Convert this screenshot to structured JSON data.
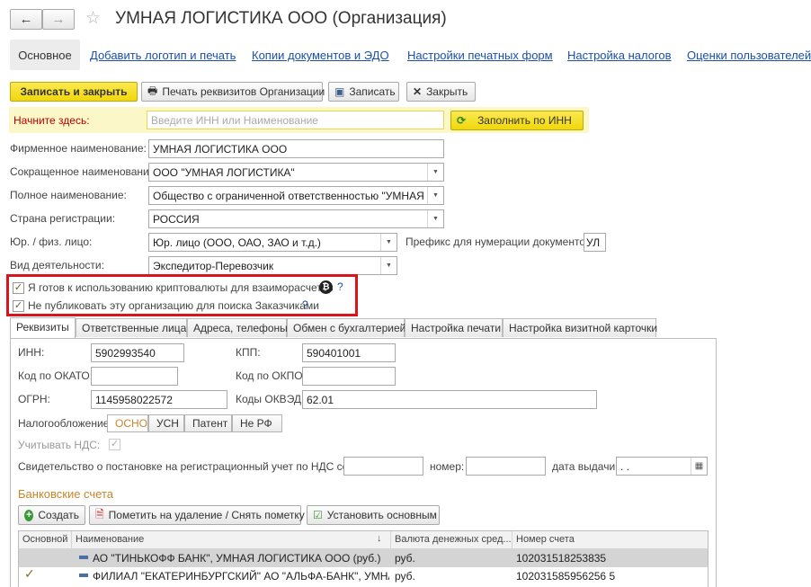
{
  "window": {
    "title": "УМНАЯ ЛОГИСТИКА ООО (Организация)",
    "back_icon": "arrow-left-icon",
    "forward_icon": "arrow-right-icon",
    "favorite_icon": "star-icon"
  },
  "nav_tabs": [
    {
      "label": "Основное"
    },
    {
      "label": "Добавить логотип и печать"
    },
    {
      "label": "Копии документов и ЭДО"
    },
    {
      "label": "Настройки печатных форм"
    },
    {
      "label": "Настройка налогов"
    },
    {
      "label": "Оценки пользователей"
    }
  ],
  "toolbar": {
    "save_close": "Записать и закрыть",
    "print_requisites": "Печать реквизитов Организации",
    "save": "Записать",
    "close": "Закрыть"
  },
  "start": {
    "label": "Начните здесь:",
    "placeholder": "Введите ИНН или Наименование",
    "fill_button": "Заполнить по ИНН"
  },
  "fields": {
    "firm_name_label": "Фирменное наименование:",
    "firm_name_value": "УМНАЯ ЛОГИСТИКА ООО",
    "short_name_label": "Сокращенное наименование:",
    "short_name_value": "ООО \"УМНАЯ ЛОГИСТИКА\"",
    "full_name_label": "Полное наименование:",
    "full_name_value": "Общество с ограниченной ответственностью \"УМНАЯ ЛОГИСТИКА\"",
    "country_label": "Страна регистрации:",
    "country_value": "РОССИЯ",
    "entity_label": "Юр. / физ. лицо:",
    "entity_value": "Юр. лицо (ООО, ОАО, ЗАО и т.д.)",
    "prefix_label": "Префикс для нумерации документов :",
    "prefix_value": "УЛ",
    "activity_label": "Вид деятельности:",
    "activity_value": "Экспедитор-Перевозчик"
  },
  "options": {
    "crypto_label": "Я готов к использованию криптовалюты для взаиморасчетов",
    "crypto_checked": true,
    "hide_label": "Не публиковать эту организацию для поиска Заказчиками",
    "hide_checked": true,
    "help": "?",
    "crypto_icon": "bitcoin-icon",
    "highlight_color": "#d9141b"
  },
  "detail_tabs": [
    {
      "label": "Реквизиты"
    },
    {
      "label": "Ответственные лица"
    },
    {
      "label": "Адреса, телефоны"
    },
    {
      "label": "Обмен с бухгалтерией"
    },
    {
      "label": "Настройка печати"
    },
    {
      "label": "Настройка визитной карточки"
    }
  ],
  "requisites": {
    "inn_label": "ИНН:",
    "inn_value": "5902993540",
    "kpp_label": "КПП:",
    "kpp_value": "590401001",
    "okato_label": "Код по ОКАТО:",
    "okato_value": "",
    "okpo_label": "Код по ОКПО:",
    "okpo_value": "",
    "ogrn_label": "ОГРН:",
    "ogrn_value": "1145958022572",
    "okved_label": "Коды ОКВЭД:",
    "okved_value": "62.01",
    "tax_label": "Налогообложение:",
    "tax_options": [
      "ОСНО",
      "УСН",
      "Патент",
      "Не РФ"
    ],
    "tax_selected": "ОСНО",
    "vat_label": "Учитывать НДС:",
    "vat_checked": true,
    "cert_label": "Свидетельство о постановке на регистрационный учет по НДС серия:",
    "cert_number_label": "номер:",
    "cert_date_label": "дата выдачи:",
    "cert_date_value": " .  .",
    "calendar_icon": "calendar-icon"
  },
  "bank": {
    "section_title": "Банковские счета",
    "create_button": "Создать",
    "mark_delete_button": "Пометить на удаление / Снять пометку",
    "set_main_button": "Установить основным",
    "columns": [
      "Основной",
      "Наименование",
      "Валюта денежных сред...",
      "Номер счета"
    ],
    "rows": [
      {
        "main": false,
        "name": "АО \"ТИНЬКОФФ БАНК\", УМНАЯ ЛОГИСТИКА ООО (руб.)",
        "currency": "руб.",
        "account": "102031518253835"
      },
      {
        "main": true,
        "name": "ФИЛИАЛ \"ЕКАТЕРИНБУРГСКИЙ\" АО \"АЛЬФА-БАНК\", УМНА...",
        "currency": "руб.",
        "account": "102031585956256 5"
      }
    ]
  },
  "colors": {
    "accent_yellow": "#f5e335",
    "link_blue": "#1c4fa8",
    "section_orange": "#c8852a"
  }
}
